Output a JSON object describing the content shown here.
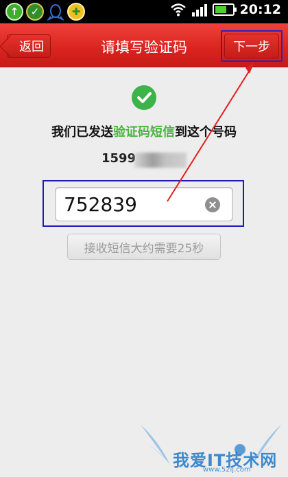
{
  "status_bar": {
    "time": "20:12",
    "apps": [
      "upload-icon",
      "check-shield-icon",
      "qq-icon",
      "plus-icon"
    ]
  },
  "header": {
    "back_label": "返回",
    "title": "请填写验证码",
    "next_label": "下一步"
  },
  "main": {
    "sent_prefix": "我们已发送",
    "sent_highlight": "验证码短信",
    "sent_suffix": "到这个号码",
    "phone_visible": "1599",
    "code_value": "752839",
    "resend_label": "接收短信大约需要25秒"
  },
  "watermark": {
    "text": "我爱IT技术网",
    "url": "www.52ij.com"
  },
  "colors": {
    "title_bar": "#d9231f",
    "highlight_green": "#4cb341",
    "annotation_red": "#e02020",
    "annotation_blue": "#1d1ab5"
  }
}
